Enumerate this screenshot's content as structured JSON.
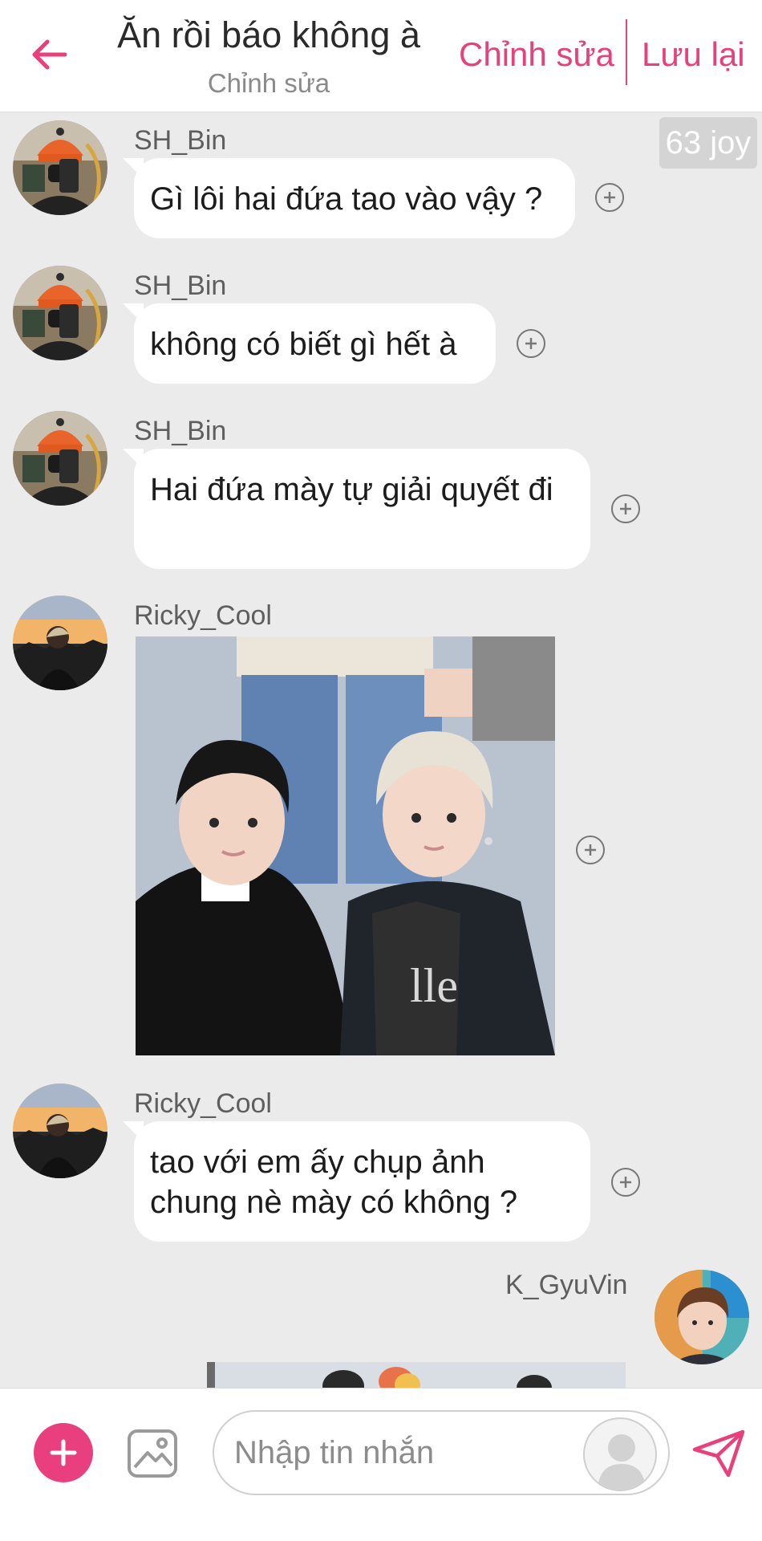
{
  "header": {
    "title": "Ăn rồi báo không à",
    "subtitle": "Chỉnh sửa",
    "edit_label": "Chỉnh sửa",
    "save_label": "Lưu lại"
  },
  "badge": {
    "text": "63 joy"
  },
  "messages": [
    {
      "sender": "SH_Bin",
      "text": "Gì lôi hai đứa tao vào vậy ?"
    },
    {
      "sender": "SH_Bin",
      "text": "không có biết gì hết à"
    },
    {
      "sender": "SH_Bin",
      "text": "Hai đứa mày tự giải quyết đi"
    },
    {
      "sender": "Ricky_Cool",
      "type": "image"
    },
    {
      "sender": "Ricky_Cool",
      "text": "tao với em ấy chụp ảnh chung nè mày có không ?"
    },
    {
      "sender": "K_GyuVin",
      "type": "image"
    }
  ],
  "composer": {
    "placeholder": "Nhập tin nhắn"
  },
  "colors": {
    "accent": "#e8407a",
    "background": "#ebebeb",
    "bubble": "#ffffff"
  },
  "icons": [
    "back-arrow-icon",
    "add-reaction-icon",
    "plus-icon",
    "image-icon",
    "sticker-icon",
    "send-icon"
  ]
}
